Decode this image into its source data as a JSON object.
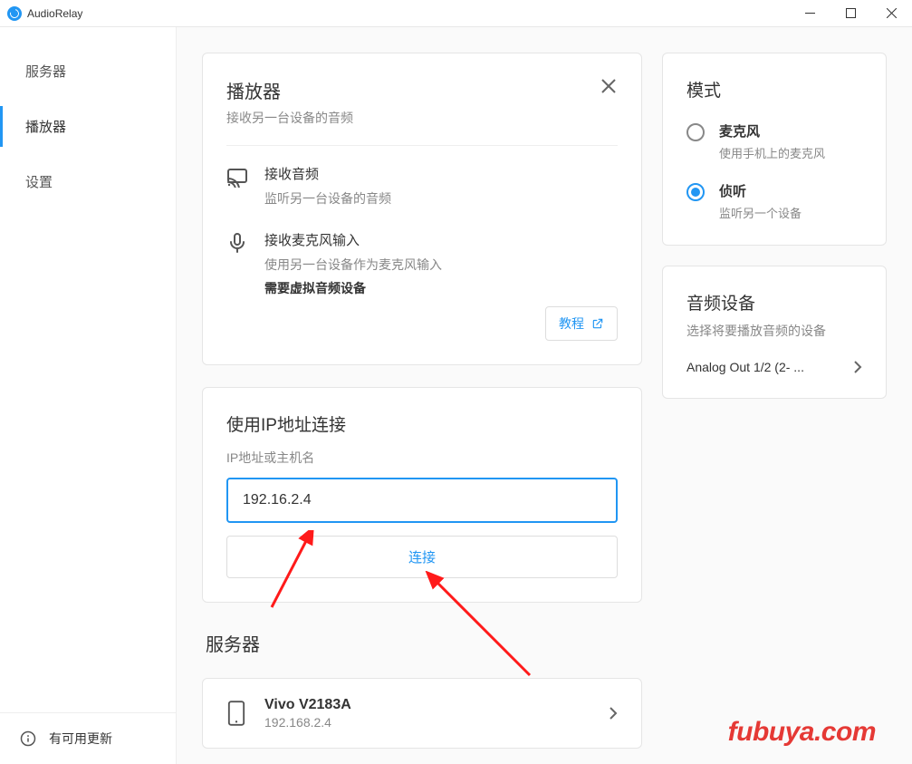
{
  "window": {
    "title": "AudioRelay"
  },
  "sidebar": {
    "items": [
      {
        "label": "服务器"
      },
      {
        "label": "播放器"
      },
      {
        "label": "设置"
      }
    ],
    "update": "有可用更新"
  },
  "player_card": {
    "title": "播放器",
    "subtitle": "接收另一台设备的音频",
    "opt1": {
      "title": "接收音频",
      "desc": "监听另一台设备的音频"
    },
    "opt2": {
      "title": "接收麦克风输入",
      "desc": "使用另一台设备作为麦克风输入",
      "warn": "需要虚拟音频设备"
    },
    "tutorial": "教程"
  },
  "ip_card": {
    "title": "使用IP地址连接",
    "label": "IP地址或主机名",
    "value": "192.16.2.4",
    "connect": "连接"
  },
  "servers": {
    "heading": "服务器",
    "item": {
      "name": "Vivo V2183A",
      "ip": "192.168.2.4"
    }
  },
  "mode_card": {
    "title": "模式",
    "opt1": {
      "title": "麦克风",
      "desc": "使用手机上的麦克风"
    },
    "opt2": {
      "title": "侦听",
      "desc": "监听另一个设备"
    }
  },
  "device_card": {
    "title": "音频设备",
    "subtitle": "选择将要播放音频的设备",
    "selected": "Analog Out 1/2 (2- ..."
  },
  "watermark": "fubuya.com"
}
